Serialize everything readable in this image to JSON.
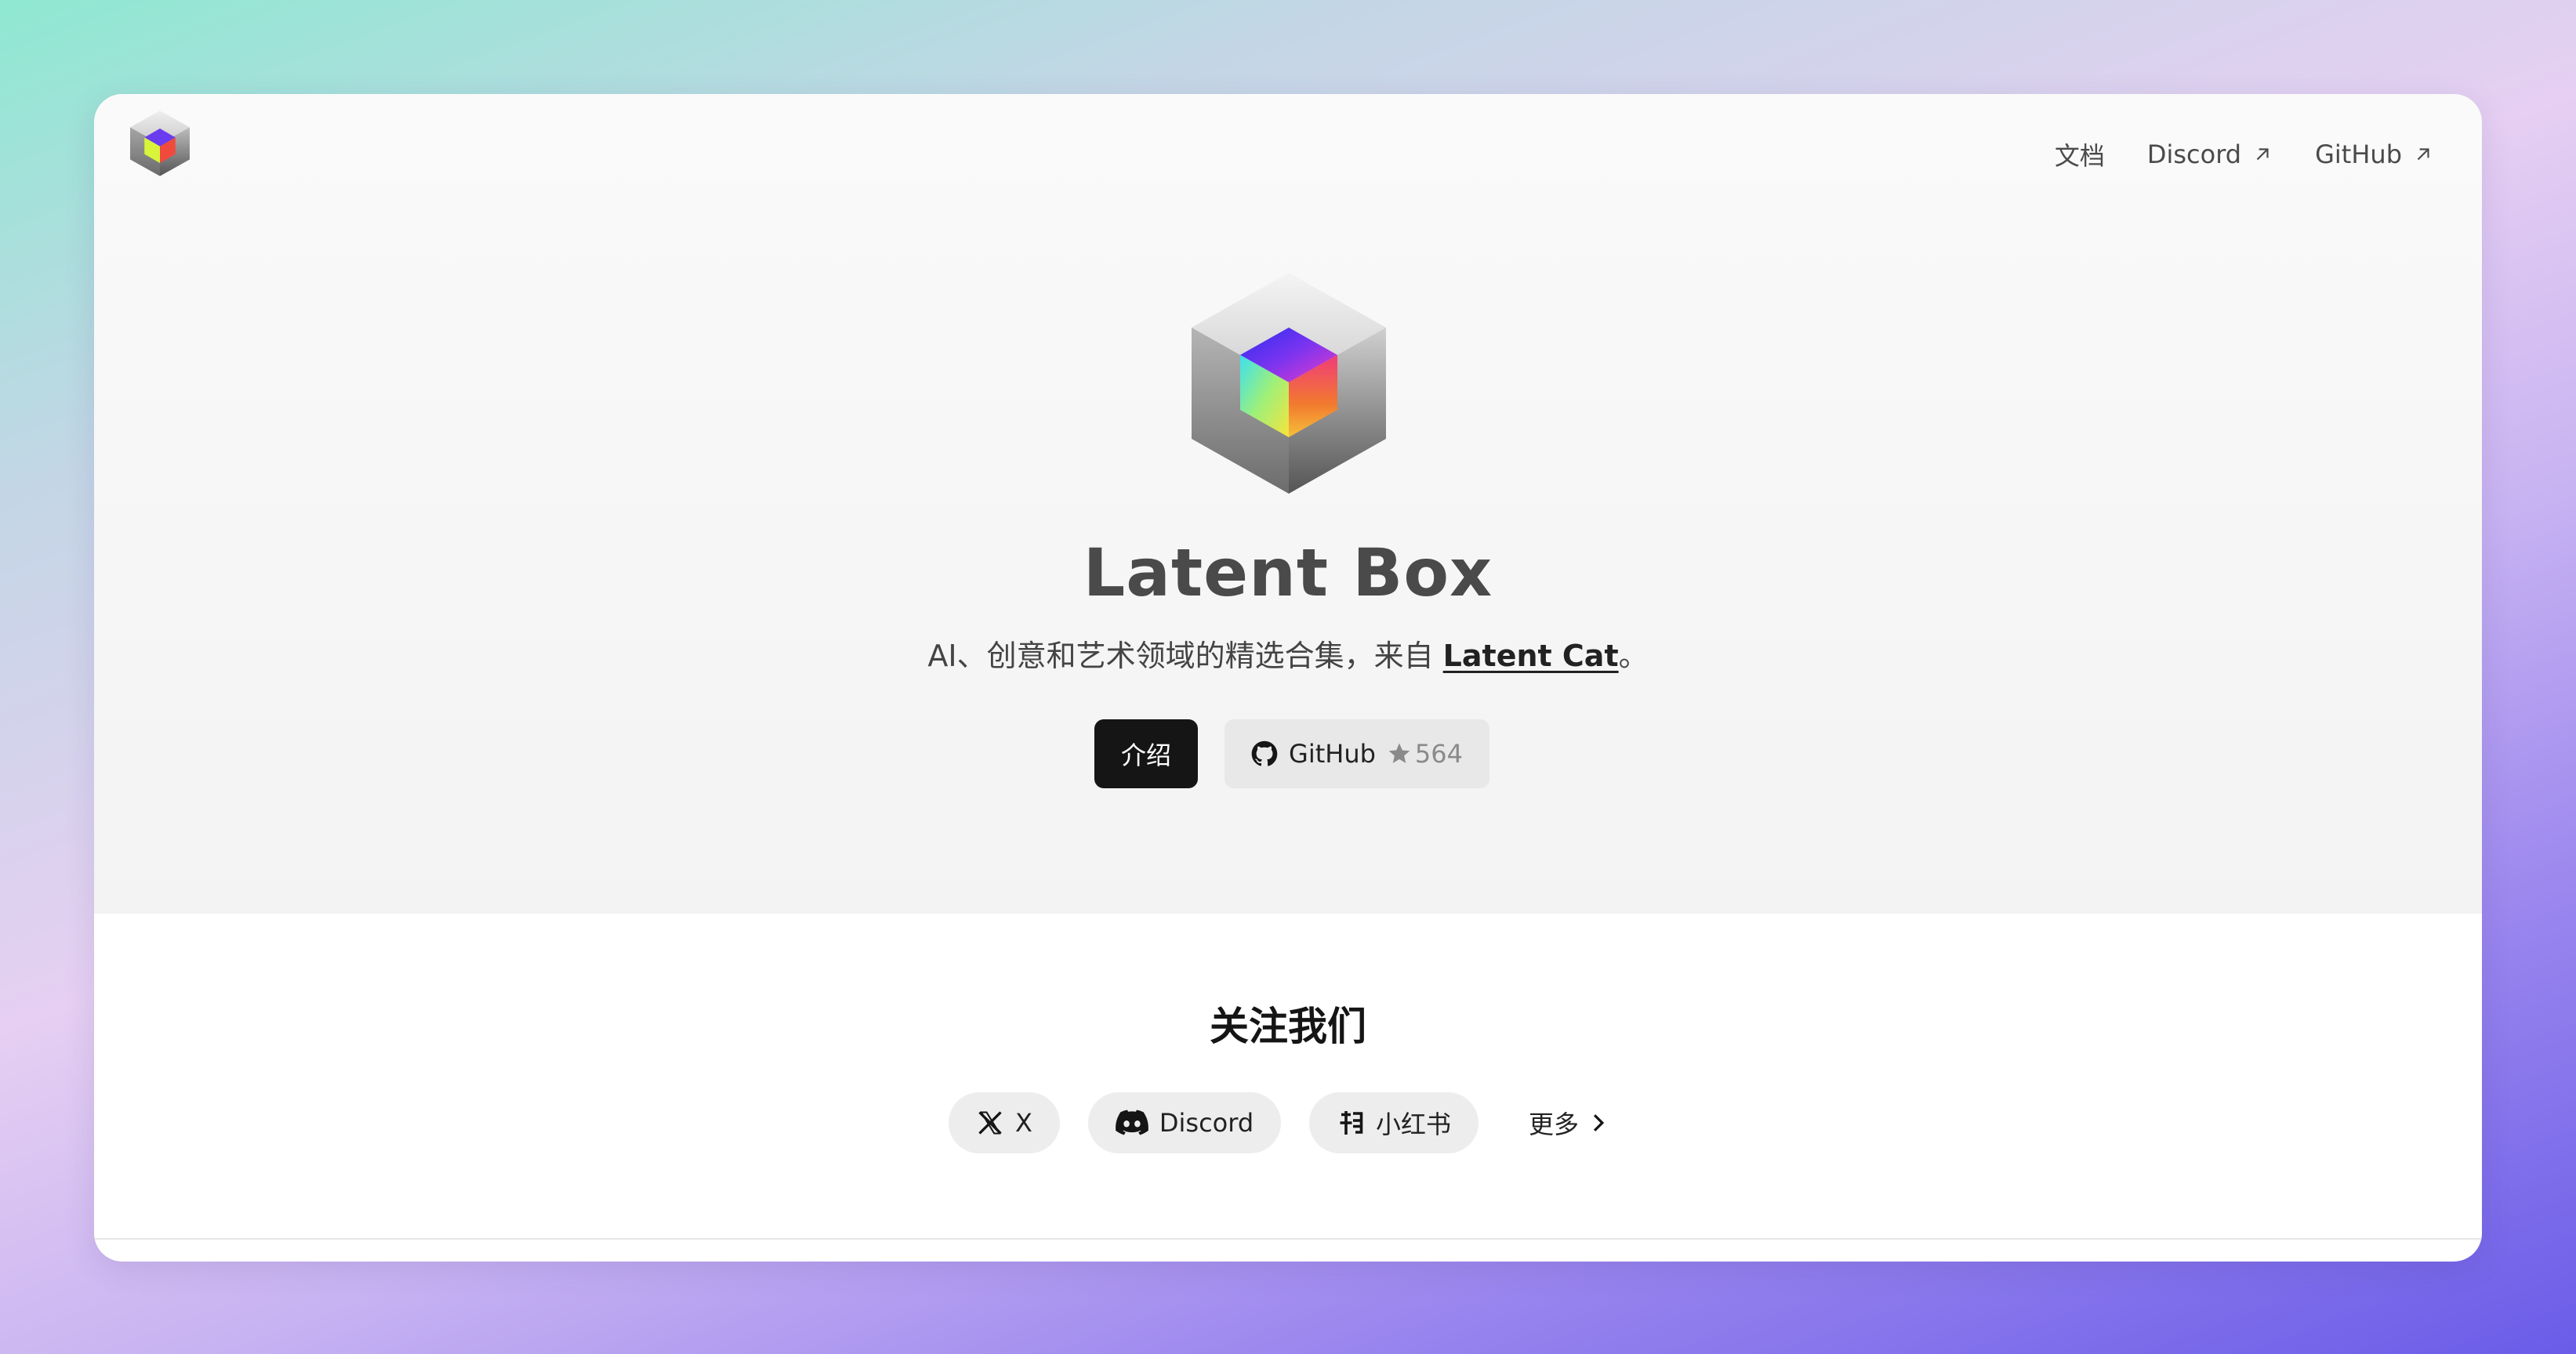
{
  "nav": {
    "logo_icon": "latent-box-cube-logo",
    "links": [
      {
        "label": "文档",
        "external": false
      },
      {
        "label": "Discord",
        "external": true
      },
      {
        "label": "GitHub",
        "external": true
      }
    ]
  },
  "hero": {
    "logo_icon": "latent-box-cube-logo",
    "title": "Latent Box",
    "subtitle_prefix": "AI、创意和艺术领域的精选合集，来自 ",
    "subtitle_link": "Latent Cat",
    "subtitle_suffix": "。",
    "buttons": {
      "intro_label": "介绍",
      "github_label": "GitHub",
      "github_stars": "564"
    }
  },
  "follow": {
    "heading": "关注我们",
    "links": [
      {
        "label": "X",
        "icon": "x-logo-icon"
      },
      {
        "label": "Discord",
        "icon": "discord-icon"
      },
      {
        "label": "小红书",
        "icon": "xiaohongshu-icon"
      },
      {
        "label": "更多",
        "icon": "chevron-right-icon"
      }
    ]
  },
  "colors": {
    "primary_button": "#151515",
    "secondary_button": "#e8e8e8",
    "pill_background": "#ededed",
    "text": "#4a4a4a"
  }
}
